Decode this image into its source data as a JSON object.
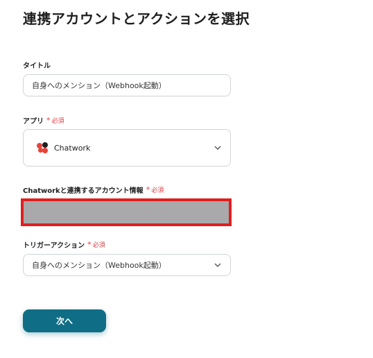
{
  "page": {
    "title": "連携アカウントとアクションを選択"
  },
  "fields": {
    "title": {
      "label": "タイトル",
      "value": "自身へのメンション（Webhook起動）"
    },
    "app": {
      "label": "アプリ",
      "required": "必須",
      "value": "Chatwork",
      "icon": "chatwork-logo"
    },
    "account": {
      "label": "Chatworkと連携するアカウント情報",
      "required": "必須"
    },
    "trigger": {
      "label": "トリガーアクション",
      "required": "必須",
      "value": "自身へのメンション（Webhook起動）"
    }
  },
  "actions": {
    "next_label": "次へ"
  },
  "colors": {
    "accent": "#0f6e85",
    "required": "#e0393e",
    "highlight": "#e01e1e"
  }
}
